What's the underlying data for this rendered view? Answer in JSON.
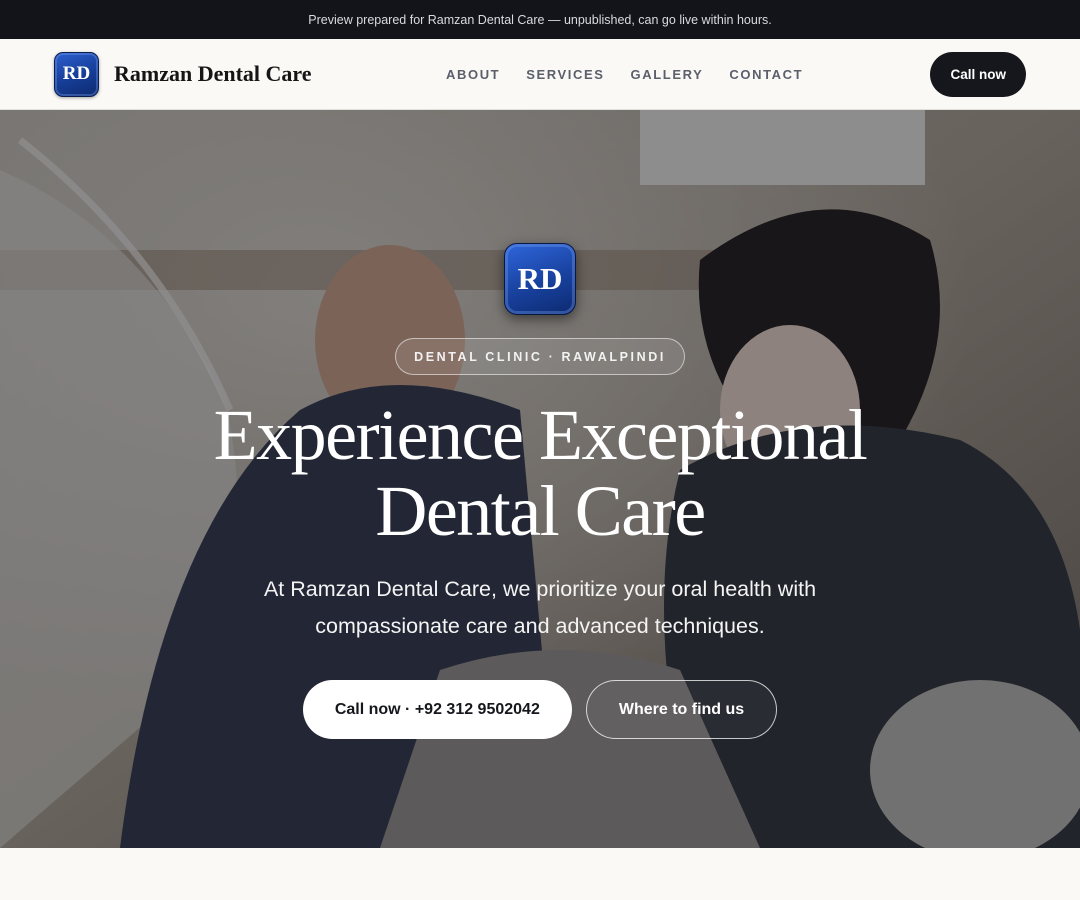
{
  "announcement": "Preview prepared for Ramzan Dental Care — unpublished, can go live within hours.",
  "brand": {
    "initials": "RD",
    "name": "Ramzan Dental Care",
    "logo_color": "#163d96"
  },
  "nav": {
    "links": [
      "ABOUT",
      "SERVICES",
      "GALLERY",
      "CONTACT"
    ],
    "cta_label": "Call now"
  },
  "hero": {
    "logo_initials": "RD",
    "eyebrow": "DENTAL CLINIC · RAWALPINDI",
    "title_line1": "Experience Exceptional",
    "title_line2": "Dental Care",
    "subtitle": "At Ramzan Dental Care, we prioritize your oral health with compassionate care and advanced techniques.",
    "primary_button": "Call now · +92 312 9502042",
    "secondary_button": "Where to find us",
    "background_image": "dentists-treating-patient-photo"
  },
  "colors": {
    "topbar_bg": "#131419",
    "page_bg": "#faf9f6",
    "dark_button": "#16171c"
  }
}
